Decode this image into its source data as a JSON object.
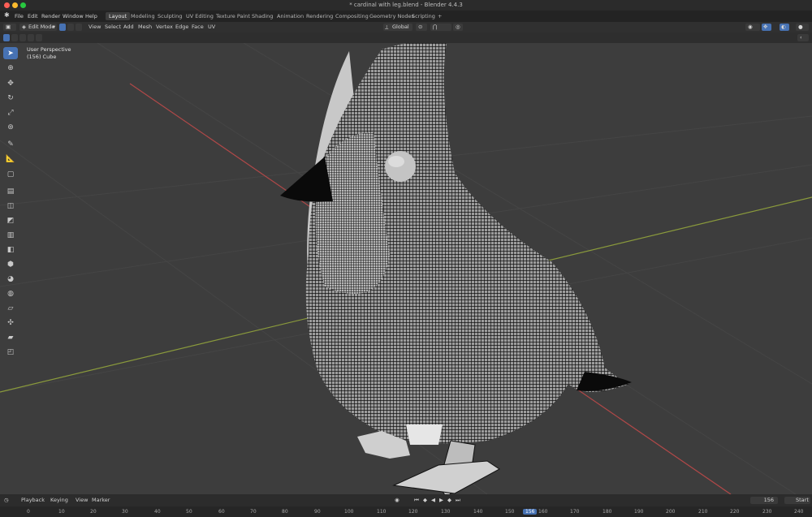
{
  "window": {
    "title": "* cardinal with leg.blend - Blender 4.4.3"
  },
  "menu": {
    "items": [
      "File",
      "Edit",
      "Render",
      "Window",
      "Help"
    ]
  },
  "workspaces": {
    "tabs": [
      "Layout",
      "Modeling",
      "Sculpting",
      "UV Editing",
      "Texture Paint",
      "Shading",
      "Animation",
      "Rendering",
      "Compositing",
      "Geometry Nodes",
      "Scripting"
    ],
    "active": "Layout",
    "add": "+"
  },
  "header": {
    "mode": "Edit Mode",
    "menus": [
      "View",
      "Select",
      "Add",
      "Mesh",
      "Vertex",
      "Edge",
      "Face",
      "UV"
    ],
    "orientation": "Global"
  },
  "viewport": {
    "perspective": "User Perspective",
    "object": "(156) Cube"
  },
  "timeline": {
    "menus": [
      "Playback",
      "Keying",
      "View",
      "Marker"
    ],
    "current_frame": "156",
    "start_label": "Start",
    "frames": [
      "0",
      "10",
      "20",
      "30",
      "40",
      "50",
      "60",
      "70",
      "80",
      "90",
      "100",
      "110",
      "120",
      "130",
      "140",
      "150",
      "160",
      "170",
      "180",
      "190",
      "200",
      "210",
      "220",
      "230",
      "240"
    ]
  },
  "colors": {
    "accent": "#4772b3",
    "x_axis": "#b04848",
    "y_axis": "#8a9a3c"
  }
}
